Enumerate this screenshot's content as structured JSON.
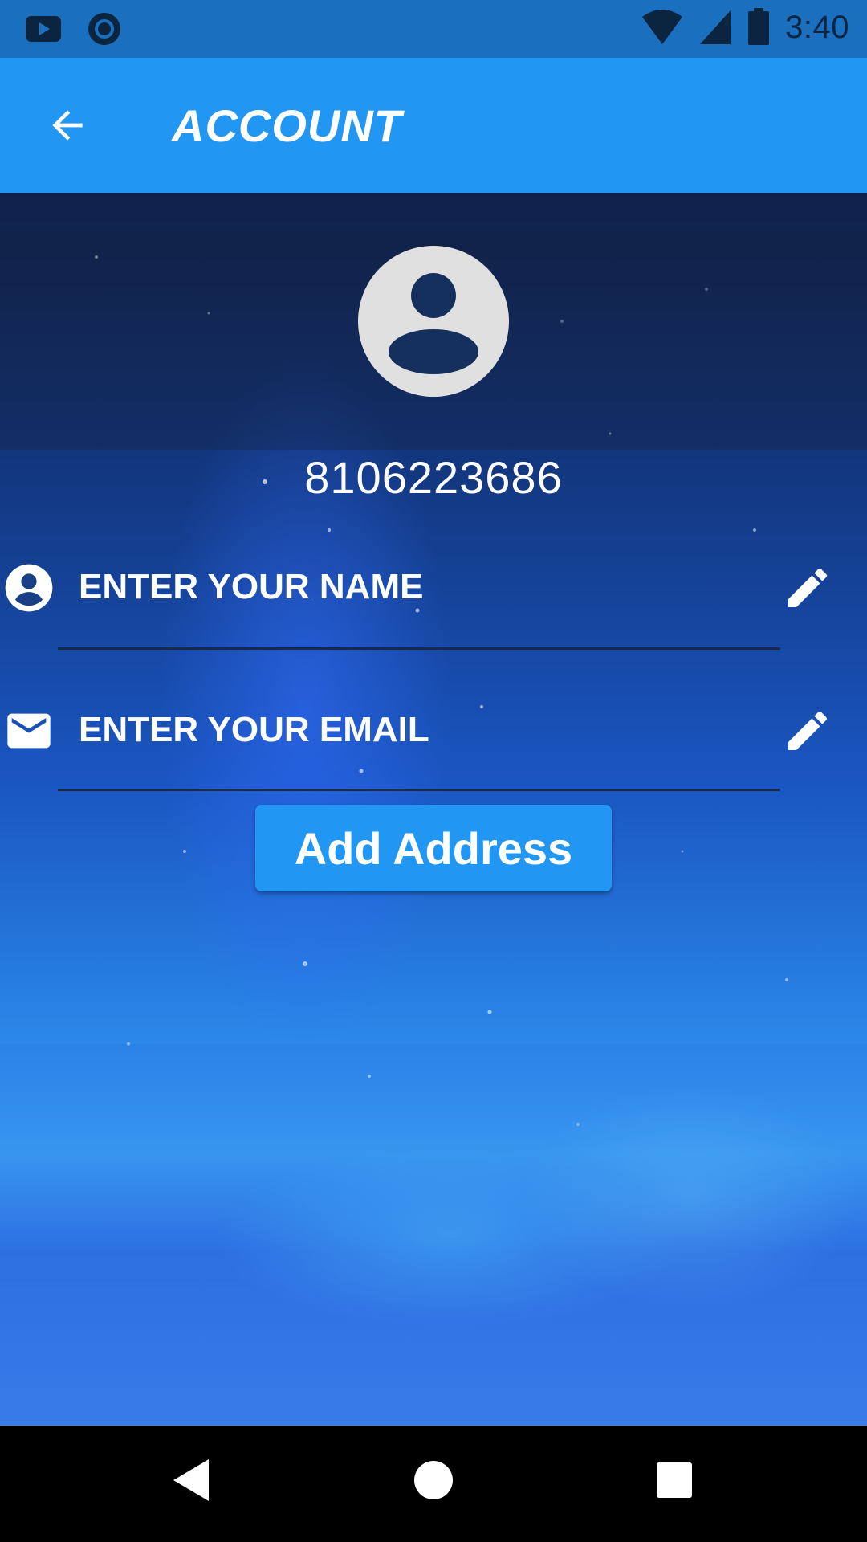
{
  "status_bar": {
    "time": "3:40",
    "icons": [
      "youtube-icon",
      "sync-icon",
      "wifi-icon",
      "signal-icon",
      "battery-icon"
    ]
  },
  "app_bar": {
    "title": "ACCOUNT",
    "back_icon": "arrow-back-icon"
  },
  "profile": {
    "avatar_icon": "account-circle-icon",
    "phone": "8106223686"
  },
  "fields": {
    "name": {
      "placeholder": "ENTER YOUR NAME",
      "value": "",
      "icon": "person-icon",
      "edit_icon": "pencil-icon"
    },
    "email": {
      "placeholder": "ENTER YOUR EMAIL",
      "value": "",
      "icon": "mail-icon",
      "edit_icon": "pencil-icon"
    }
  },
  "actions": {
    "add_address": "Add Address"
  },
  "nav_bar": {
    "buttons": [
      "back-icon",
      "home-icon",
      "recents-icon"
    ]
  },
  "colors": {
    "primary": "#2196f3",
    "status_bar": "#1a6fbf",
    "text_on_primary": "#ffffff"
  }
}
